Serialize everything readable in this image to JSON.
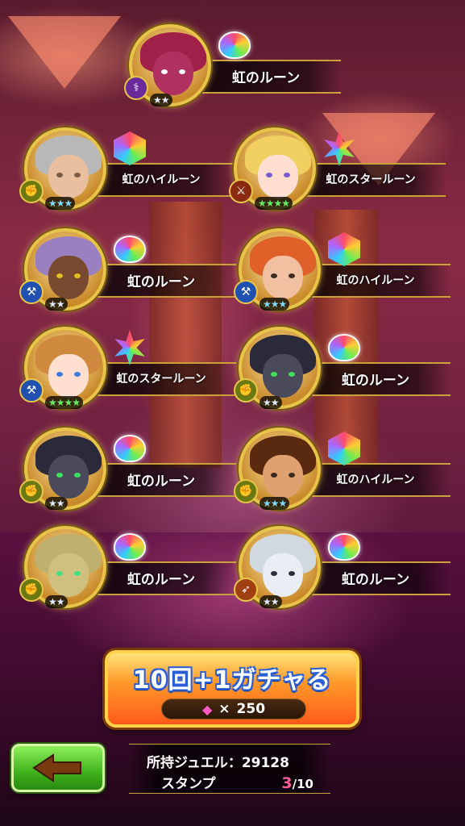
{
  "results": [
    {
      "rune": "虹のルーン",
      "rune_shape": "round",
      "stars": "★★",
      "star_color": "silver",
      "type_icon": "staff-icon",
      "type_color": "#6a2a9a",
      "hair": "#a0204a",
      "skin": "#b03060",
      "eye": "#ffffff"
    },
    {
      "rune": "虹のハイルーン",
      "rune_shape": "hex",
      "stars": "★★★",
      "star_color": "blue",
      "type_icon": "fist-icon",
      "type_color": "#6a7a10",
      "hair": "#b8b8b8",
      "skin": "#e8c0a0",
      "eye": "#7a5a40"
    },
    {
      "rune": "虹のスタールーン",
      "rune_shape": "star",
      "stars": "★★★★",
      "star_color": "green",
      "type_icon": "sword-icon",
      "type_color": "#8a2a10",
      "hair": "#f0d060",
      "skin": "#ffe0d0",
      "eye": "#7a5ad0"
    },
    {
      "rune": "虹のルーン",
      "rune_shape": "round",
      "stars": "★★",
      "star_color": "silver",
      "type_icon": "axe-icon",
      "type_color": "#2050b0",
      "hair": "#9a80c0",
      "skin": "#7a4a30",
      "eye": "#e0c020"
    },
    {
      "rune": "虹のハイルーン",
      "rune_shape": "hex",
      "stars": "★★★",
      "star_color": "blue",
      "type_icon": "axe-icon",
      "type_color": "#2050b0",
      "hair": "#e0602a",
      "skin": "#f0c0a0",
      "eye": "#3a2a20"
    },
    {
      "rune": "虹のスタールーン",
      "rune_shape": "star",
      "stars": "★★★★",
      "star_color": "green",
      "type_icon": "axe-icon",
      "type_color": "#2050b0",
      "hair": "#d08a40",
      "skin": "#ffe0d0",
      "eye": "#3a7ae0"
    },
    {
      "rune": "虹のルーン",
      "rune_shape": "round",
      "stars": "★★",
      "star_color": "silver",
      "type_icon": "fist-icon",
      "type_color": "#6a7a10",
      "hair": "#2a2a3a",
      "skin": "#4a4a5a",
      "eye": "#40e060"
    },
    {
      "rune": "虹のルーン",
      "rune_shape": "round",
      "stars": "★★",
      "star_color": "silver",
      "type_icon": "fist-icon",
      "type_color": "#6a7a10",
      "hair": "#2a2a3a",
      "skin": "#4a4a5a",
      "eye": "#40e060"
    },
    {
      "rune": "虹のハイルーン",
      "rune_shape": "hex",
      "stars": "★★★",
      "star_color": "blue",
      "type_icon": "fist-icon",
      "type_color": "#6a7a10",
      "hair": "#5a2a10",
      "skin": "#e0a070",
      "eye": "#3a2a20"
    },
    {
      "rune": "虹のルーン",
      "rune_shape": "round",
      "stars": "★★",
      "star_color": "silver",
      "type_icon": "fist-icon",
      "type_color": "#6a7a10",
      "hair": "#c0b070",
      "skin": "#d0c080",
      "eye": "#40e080"
    },
    {
      "rune": "虹のルーン",
      "rune_shape": "round",
      "stars": "★★",
      "star_color": "silver",
      "type_icon": "bow-icon",
      "type_color": "#a04010",
      "hair": "#d0d8e0",
      "skin": "#e8eef4",
      "eye": "#2a2a3a"
    }
  ],
  "gacha_button": {
    "label": "10回+1ガチャる",
    "cost_prefix": "×",
    "cost": "250",
    "cost_icon": "gem-icon"
  },
  "info": {
    "jewel_label": "所持ジュエル",
    "jewel_sep": "：",
    "jewel_value": "29128",
    "stamp_label": "スタンプ",
    "stamp_current": "3",
    "stamp_sep": "/",
    "stamp_max": "10"
  },
  "back_button": {
    "icon": "arrow-left-icon"
  },
  "colors": {
    "accent_gold": "#e8c54a",
    "gacha_orange": "#ff7a2a",
    "back_green": "#3fb21c"
  }
}
